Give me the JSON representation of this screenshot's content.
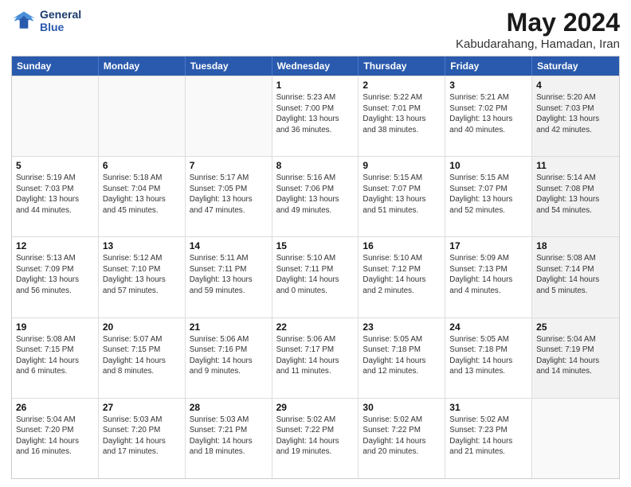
{
  "header": {
    "logo_line1": "General",
    "logo_line2": "Blue",
    "title": "May 2024",
    "subtitle": "Kabudarahang, Hamadan, Iran"
  },
  "weekdays": [
    "Sunday",
    "Monday",
    "Tuesday",
    "Wednesday",
    "Thursday",
    "Friday",
    "Saturday"
  ],
  "rows": [
    [
      {
        "day": "",
        "text": "",
        "shaded": false,
        "empty": true
      },
      {
        "day": "",
        "text": "",
        "shaded": false,
        "empty": true
      },
      {
        "day": "",
        "text": "",
        "shaded": false,
        "empty": true
      },
      {
        "day": "1",
        "text": "Sunrise: 5:23 AM\nSunset: 7:00 PM\nDaylight: 13 hours\nand 36 minutes.",
        "shaded": false,
        "empty": false
      },
      {
        "day": "2",
        "text": "Sunrise: 5:22 AM\nSunset: 7:01 PM\nDaylight: 13 hours\nand 38 minutes.",
        "shaded": false,
        "empty": false
      },
      {
        "day": "3",
        "text": "Sunrise: 5:21 AM\nSunset: 7:02 PM\nDaylight: 13 hours\nand 40 minutes.",
        "shaded": false,
        "empty": false
      },
      {
        "day": "4",
        "text": "Sunrise: 5:20 AM\nSunset: 7:03 PM\nDaylight: 13 hours\nand 42 minutes.",
        "shaded": true,
        "empty": false
      }
    ],
    [
      {
        "day": "5",
        "text": "Sunrise: 5:19 AM\nSunset: 7:03 PM\nDaylight: 13 hours\nand 44 minutes.",
        "shaded": false,
        "empty": false
      },
      {
        "day": "6",
        "text": "Sunrise: 5:18 AM\nSunset: 7:04 PM\nDaylight: 13 hours\nand 45 minutes.",
        "shaded": false,
        "empty": false
      },
      {
        "day": "7",
        "text": "Sunrise: 5:17 AM\nSunset: 7:05 PM\nDaylight: 13 hours\nand 47 minutes.",
        "shaded": false,
        "empty": false
      },
      {
        "day": "8",
        "text": "Sunrise: 5:16 AM\nSunset: 7:06 PM\nDaylight: 13 hours\nand 49 minutes.",
        "shaded": false,
        "empty": false
      },
      {
        "day": "9",
        "text": "Sunrise: 5:15 AM\nSunset: 7:07 PM\nDaylight: 13 hours\nand 51 minutes.",
        "shaded": false,
        "empty": false
      },
      {
        "day": "10",
        "text": "Sunrise: 5:15 AM\nSunset: 7:07 PM\nDaylight: 13 hours\nand 52 minutes.",
        "shaded": false,
        "empty": false
      },
      {
        "day": "11",
        "text": "Sunrise: 5:14 AM\nSunset: 7:08 PM\nDaylight: 13 hours\nand 54 minutes.",
        "shaded": true,
        "empty": false
      }
    ],
    [
      {
        "day": "12",
        "text": "Sunrise: 5:13 AM\nSunset: 7:09 PM\nDaylight: 13 hours\nand 56 minutes.",
        "shaded": false,
        "empty": false
      },
      {
        "day": "13",
        "text": "Sunrise: 5:12 AM\nSunset: 7:10 PM\nDaylight: 13 hours\nand 57 minutes.",
        "shaded": false,
        "empty": false
      },
      {
        "day": "14",
        "text": "Sunrise: 5:11 AM\nSunset: 7:11 PM\nDaylight: 13 hours\nand 59 minutes.",
        "shaded": false,
        "empty": false
      },
      {
        "day": "15",
        "text": "Sunrise: 5:10 AM\nSunset: 7:11 PM\nDaylight: 14 hours\nand 0 minutes.",
        "shaded": false,
        "empty": false
      },
      {
        "day": "16",
        "text": "Sunrise: 5:10 AM\nSunset: 7:12 PM\nDaylight: 14 hours\nand 2 minutes.",
        "shaded": false,
        "empty": false
      },
      {
        "day": "17",
        "text": "Sunrise: 5:09 AM\nSunset: 7:13 PM\nDaylight: 14 hours\nand 4 minutes.",
        "shaded": false,
        "empty": false
      },
      {
        "day": "18",
        "text": "Sunrise: 5:08 AM\nSunset: 7:14 PM\nDaylight: 14 hours\nand 5 minutes.",
        "shaded": true,
        "empty": false
      }
    ],
    [
      {
        "day": "19",
        "text": "Sunrise: 5:08 AM\nSunset: 7:15 PM\nDaylight: 14 hours\nand 6 minutes.",
        "shaded": false,
        "empty": false
      },
      {
        "day": "20",
        "text": "Sunrise: 5:07 AM\nSunset: 7:15 PM\nDaylight: 14 hours\nand 8 minutes.",
        "shaded": false,
        "empty": false
      },
      {
        "day": "21",
        "text": "Sunrise: 5:06 AM\nSunset: 7:16 PM\nDaylight: 14 hours\nand 9 minutes.",
        "shaded": false,
        "empty": false
      },
      {
        "day": "22",
        "text": "Sunrise: 5:06 AM\nSunset: 7:17 PM\nDaylight: 14 hours\nand 11 minutes.",
        "shaded": false,
        "empty": false
      },
      {
        "day": "23",
        "text": "Sunrise: 5:05 AM\nSunset: 7:18 PM\nDaylight: 14 hours\nand 12 minutes.",
        "shaded": false,
        "empty": false
      },
      {
        "day": "24",
        "text": "Sunrise: 5:05 AM\nSunset: 7:18 PM\nDaylight: 14 hours\nand 13 minutes.",
        "shaded": false,
        "empty": false
      },
      {
        "day": "25",
        "text": "Sunrise: 5:04 AM\nSunset: 7:19 PM\nDaylight: 14 hours\nand 14 minutes.",
        "shaded": true,
        "empty": false
      }
    ],
    [
      {
        "day": "26",
        "text": "Sunrise: 5:04 AM\nSunset: 7:20 PM\nDaylight: 14 hours\nand 16 minutes.",
        "shaded": false,
        "empty": false
      },
      {
        "day": "27",
        "text": "Sunrise: 5:03 AM\nSunset: 7:20 PM\nDaylight: 14 hours\nand 17 minutes.",
        "shaded": false,
        "empty": false
      },
      {
        "day": "28",
        "text": "Sunrise: 5:03 AM\nSunset: 7:21 PM\nDaylight: 14 hours\nand 18 minutes.",
        "shaded": false,
        "empty": false
      },
      {
        "day": "29",
        "text": "Sunrise: 5:02 AM\nSunset: 7:22 PM\nDaylight: 14 hours\nand 19 minutes.",
        "shaded": false,
        "empty": false
      },
      {
        "day": "30",
        "text": "Sunrise: 5:02 AM\nSunset: 7:22 PM\nDaylight: 14 hours\nand 20 minutes.",
        "shaded": false,
        "empty": false
      },
      {
        "day": "31",
        "text": "Sunrise: 5:02 AM\nSunset: 7:23 PM\nDaylight: 14 hours\nand 21 minutes.",
        "shaded": false,
        "empty": false
      },
      {
        "day": "",
        "text": "",
        "shaded": true,
        "empty": true
      }
    ]
  ]
}
